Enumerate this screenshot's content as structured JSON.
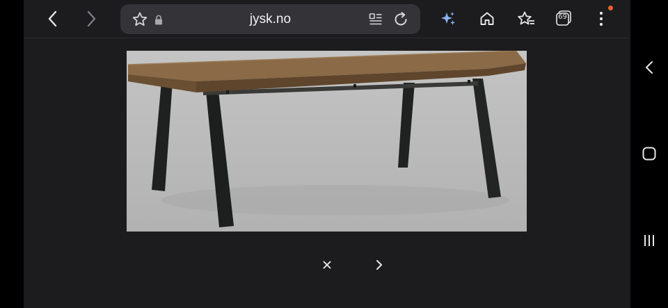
{
  "browser": {
    "url": "jysk.no",
    "tab_count": "69",
    "accent_color": "#8ab4f8",
    "notification_dot_color": "#e8622c"
  },
  "toolbar": {
    "icons": [
      "back-icon",
      "forward-icon",
      "bookmark-star-icon",
      "lock-icon",
      "reader-mode-icon",
      "reload-icon",
      "ai-sparkle-icon",
      "home-icon",
      "bookmarks-icon",
      "tabs-icon",
      "more-icon"
    ]
  },
  "gallery": {
    "image_subject": "dining-table",
    "controls": [
      "close-icon",
      "next-icon"
    ]
  },
  "system_nav": {
    "icons": [
      "nav-back-icon",
      "nav-home-icon",
      "nav-recents-icon"
    ]
  }
}
